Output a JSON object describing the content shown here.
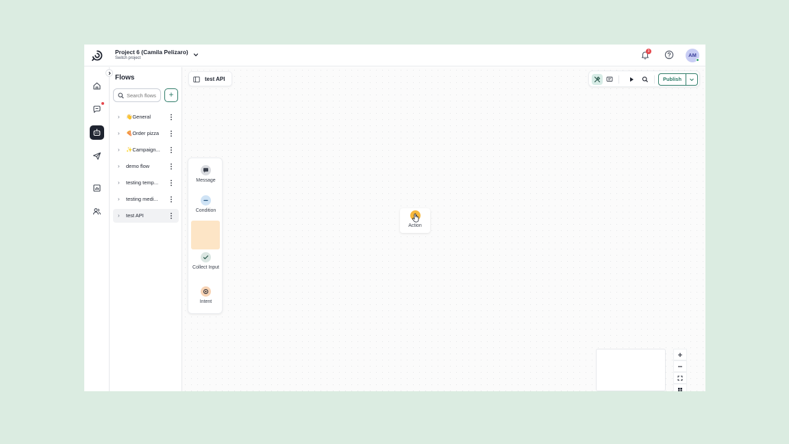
{
  "header": {
    "project_title": "Project 6 (Camila Pelizaro)",
    "project_subtitle": "Switch project",
    "notification_count": "3",
    "avatar_initials": "AM"
  },
  "rail": {
    "items": [
      "home-icon",
      "chat-icon",
      "bot-icon",
      "send-icon",
      "analytics-icon",
      "users-icon",
      "settings-icon"
    ],
    "active": "bot-icon"
  },
  "flows": {
    "title": "Flows",
    "search_placeholder": "Search flows",
    "add_label": "+",
    "items": [
      {
        "label": "👋General"
      },
      {
        "label": "🍕Order pizza"
      },
      {
        "label": "✨Campaign..."
      },
      {
        "label": "demo flow"
      },
      {
        "label": "testing temp..."
      },
      {
        "label": "testing medi..."
      },
      {
        "label": "test API"
      }
    ],
    "selected": "test API"
  },
  "canvas": {
    "flow_tab": "test API",
    "publish_label": "Publish",
    "palette": [
      {
        "label": "Message",
        "icon": "message-icon"
      },
      {
        "label": "Condition",
        "icon": "condition-icon"
      },
      {
        "label": "Collect Input",
        "icon": "collect-input-icon"
      },
      {
        "label": "Intent",
        "icon": "intent-icon"
      }
    ],
    "dragging_node": {
      "label": "Action",
      "icon": "action-icon"
    }
  },
  "colors": {
    "accent": "#2c7a67",
    "background": "#dbece1",
    "notification": "#e5484d",
    "action": "#f6b73c",
    "drop_slot": "#fde5c6"
  }
}
